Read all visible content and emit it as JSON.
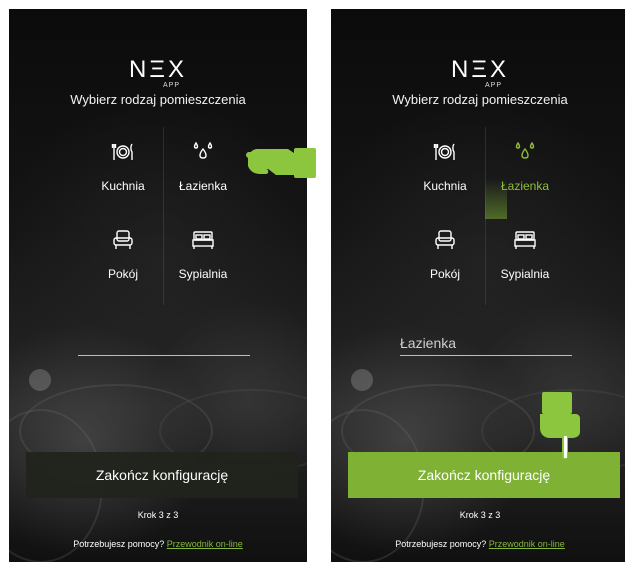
{
  "logo": {
    "main": "NΞX",
    "sub": "APP"
  },
  "subtitle": "Wybierz rodzaj pomieszczenia",
  "rooms": [
    {
      "label": "Kuchnia",
      "icon": "cutlery-icon"
    },
    {
      "label": "Łazienka",
      "icon": "water-drops-icon"
    },
    {
      "label": "Pokój",
      "icon": "armchair-icon"
    },
    {
      "label": "Sypialnia",
      "icon": "bed-icon"
    }
  ],
  "left_screen": {
    "room_name_value": "",
    "selected_room": ""
  },
  "right_screen": {
    "room_name_value": "Łazienka",
    "selected_room": "Łazienka"
  },
  "finish_button": "Zakończ konfigurację",
  "step": "Krok 3 z 3",
  "help": {
    "text": "Potrzebujesz pomocy?",
    "link": "Przewodnik on-line"
  },
  "colors": {
    "accent": "#7fb135",
    "accent_text": "#8fbf3a",
    "dark_button": "#20241c",
    "background": "#111111"
  }
}
